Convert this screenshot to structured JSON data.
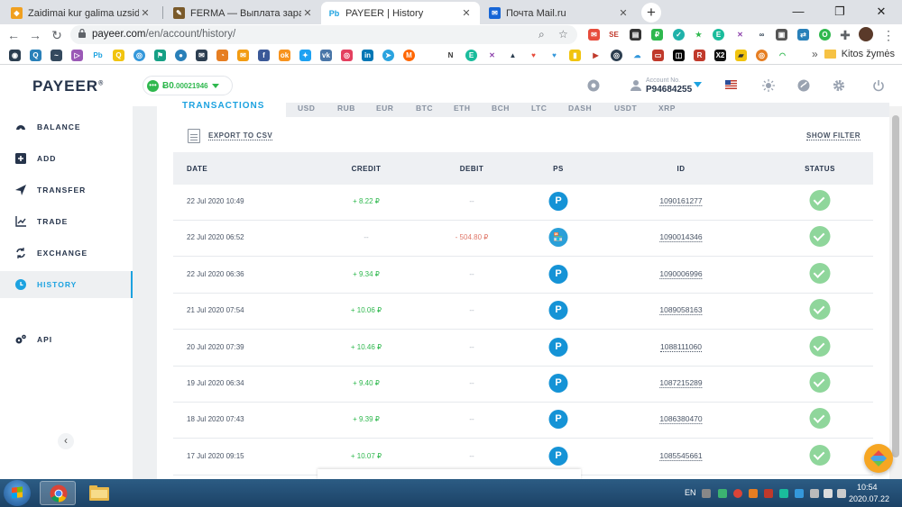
{
  "browser": {
    "tabs": [
      {
        "title": "Zaidimai kur galima uzsidirbti tik",
        "favicon": "game-icon",
        "color": "#f0a020"
      },
      {
        "title": "FERMA — Выплата заработка",
        "favicon": "ferma-icon",
        "color": "#7a5a2a"
      },
      {
        "title": "PAYEER | History",
        "favicon": "payeer-icon",
        "color": "#1ca2e0",
        "active": true
      },
      {
        "title": "Почта Mail.ru",
        "favicon": "mail-icon",
        "color": "#1766d6"
      }
    ],
    "url_host": "payeer.com",
    "url_path": "/en/account/history/",
    "bookmarks_other": "Kitos žymės"
  },
  "payeer": {
    "logo": "PAYEER",
    "logo_mark": "®",
    "wallet_balance_main": "Ƀ0",
    "wallet_balance_frac": ".00021946",
    "account_label": "Account No.",
    "account_no": "P94684255",
    "sidebar": [
      {
        "label": "BALANCE",
        "icon": "balance-icon"
      },
      {
        "label": "ADD",
        "icon": "add-icon"
      },
      {
        "label": "TRANSFER",
        "icon": "transfer-icon"
      },
      {
        "label": "TRADE",
        "icon": "trade-icon"
      },
      {
        "label": "EXCHANGE",
        "icon": "exchange-icon"
      },
      {
        "label": "HISTORY",
        "icon": "history-icon",
        "active": true
      },
      {
        "label": "API",
        "icon": "api-icon"
      }
    ],
    "transactions_title": "TRANSACTIONS",
    "currencies": [
      "USD",
      "RUB",
      "EUR",
      "BTC",
      "ETH",
      "BCH",
      "LTC",
      "DASH",
      "USDT",
      "XRP"
    ],
    "export_label": "EXPORT TO CSV",
    "show_filter": "SHOW FILTER",
    "columns": {
      "date": "DATE",
      "credit": "CREDIT",
      "debit": "DEBIT",
      "ps": "PS",
      "id": "ID",
      "status": "STATUS"
    },
    "rows": [
      {
        "date": "22 Jul 2020 10:49",
        "credit": "+ 8.22 ₽",
        "debit": "--",
        "ps": "P",
        "id": "1090161277",
        "status": "completed"
      },
      {
        "date": "22 Jul 2020 06:52",
        "credit": "--",
        "debit": "- 504.80 ₽",
        "ps": "shop",
        "id": "1090014346",
        "status": "completed"
      },
      {
        "date": "22 Jul 2020 06:36",
        "credit": "+ 9.34 ₽",
        "debit": "--",
        "ps": "P",
        "id": "1090006996",
        "status": "completed"
      },
      {
        "date": "21 Jul 2020 07:54",
        "credit": "+ 10.06 ₽",
        "debit": "--",
        "ps": "P",
        "id": "1089058163",
        "status": "completed"
      },
      {
        "date": "20 Jul 2020 07:39",
        "credit": "+ 10.46 ₽",
        "debit": "--",
        "ps": "P",
        "id": "1088111060",
        "status": "completed"
      },
      {
        "date": "19 Jul 2020 06:34",
        "credit": "+ 9.40 ₽",
        "debit": "--",
        "ps": "P",
        "id": "1087215289",
        "status": "completed"
      },
      {
        "date": "18 Jul 2020 07:43",
        "credit": "+ 9.39 ₽",
        "debit": "--",
        "ps": "P",
        "id": "1086380470",
        "status": "completed"
      },
      {
        "date": "17 Jul 2020 09:15",
        "credit": "+ 10.07 ₽",
        "debit": "--",
        "ps": "P",
        "id": "1085545661",
        "status": "completed"
      }
    ]
  },
  "taskbar": {
    "lang": "EN",
    "time": "10:54",
    "date": "2020.07.22"
  },
  "colors": {
    "accent": "#1ca2e0",
    "credit": "#2fb84e",
    "debit": "#e0786a",
    "status_ok": "#8fd69b"
  }
}
